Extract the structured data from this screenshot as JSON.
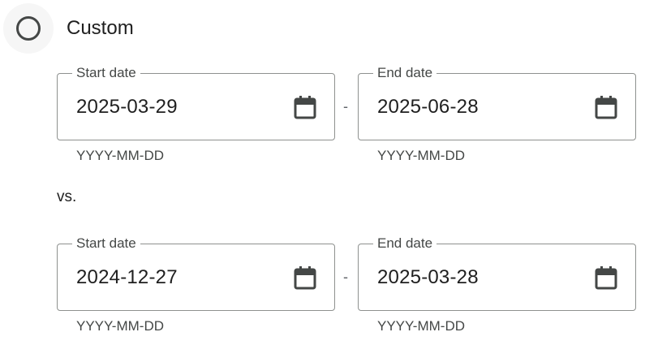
{
  "option": {
    "label": "Custom",
    "selected": false
  },
  "current_range": {
    "start": {
      "label": "Start date",
      "value": "2025-03-29",
      "helper": "YYYY-MM-DD"
    },
    "separator": "-",
    "end": {
      "label": "End date",
      "value": "2025-06-28",
      "helper": "YYYY-MM-DD"
    }
  },
  "comparison_label": "vs.",
  "compare_range": {
    "start": {
      "label": "Start date",
      "value": "2024-12-27",
      "helper": "YYYY-MM-DD"
    },
    "separator": "-",
    "end": {
      "label": "End date",
      "value": "2025-03-28",
      "helper": "YYYY-MM-DD"
    }
  },
  "icons": {
    "calendar": "calendar-icon",
    "radio": "radio-unchecked-icon"
  }
}
